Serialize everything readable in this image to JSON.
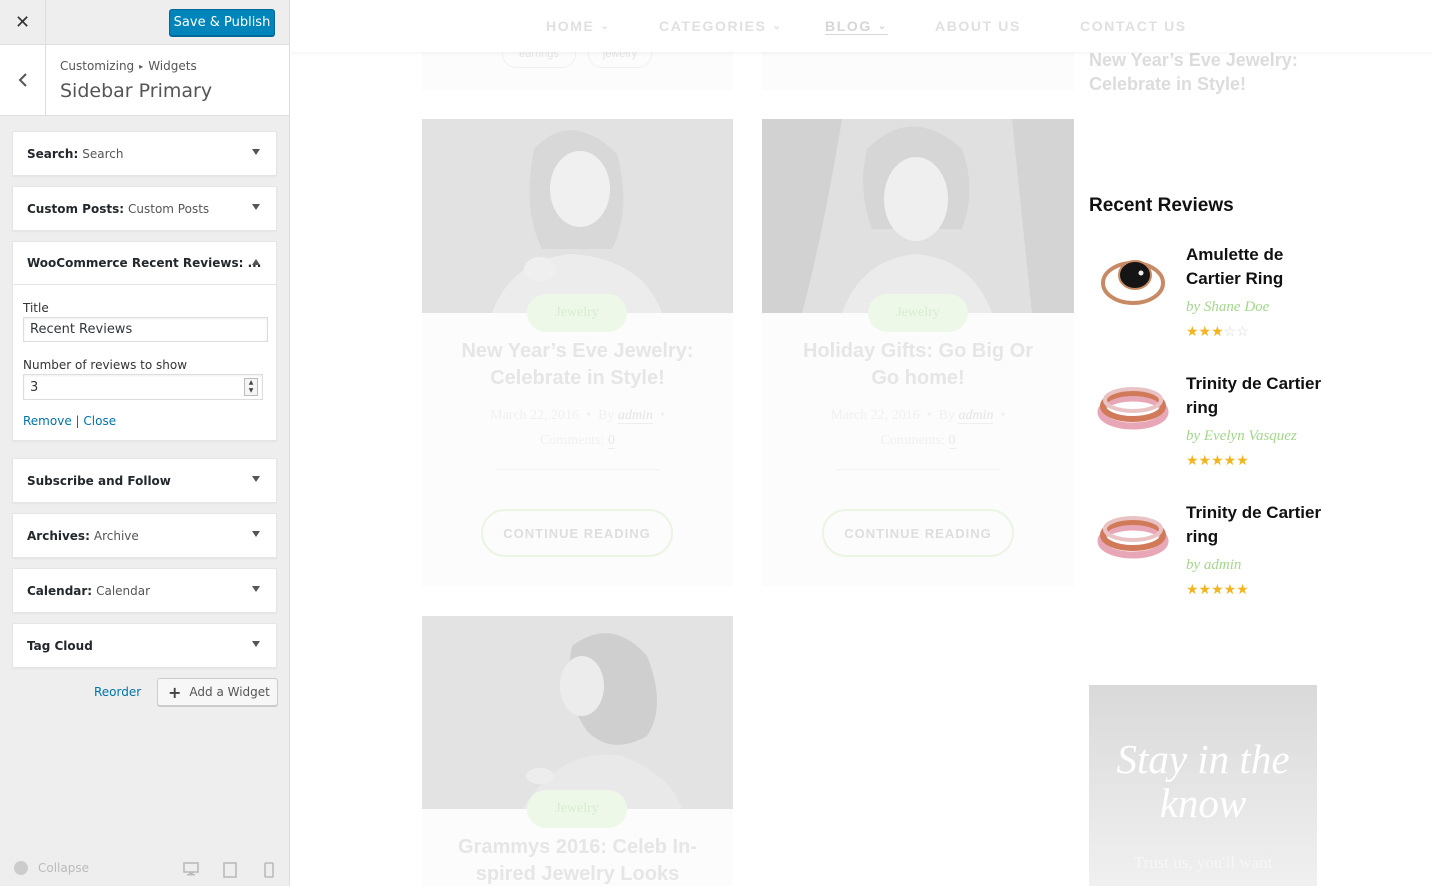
{
  "customizer": {
    "close_glyph": "✕",
    "publish_label": "Save & Publish",
    "breadcrumb": [
      "Customizing",
      "Widgets"
    ],
    "breadcrumb_sep": "▸",
    "section_title": "Sidebar Primary",
    "widgets": [
      {
        "name": "Search:",
        "title": "Search"
      },
      {
        "name": "Custom Posts:",
        "title": "Custom Posts"
      },
      {
        "name": "WooCommerce Recent Reviews: ...",
        "title": ""
      },
      {
        "name": "Subscribe and Follow",
        "title": ""
      },
      {
        "name": "Archives:",
        "title": "Archive"
      },
      {
        "name": "Calendar:",
        "title": "Calendar"
      },
      {
        "name": "Tag Cloud",
        "title": ""
      }
    ],
    "open_widget": {
      "title_label": "Title",
      "title_value": "Recent Reviews",
      "count_label": "Number of reviews to show",
      "count_value": "3",
      "remove_label": "Remove",
      "separator": "|",
      "close_label": "Close"
    },
    "reorder_label": "Reorder",
    "add_widget_label": "Add a Widget",
    "collapse_label": "Collapse"
  },
  "preview": {
    "nav": [
      "HOME",
      "CATEGORIES",
      "BLOG",
      "ABOUT US",
      "CONTACT US"
    ],
    "tags_top": [
      "earrings",
      "jewelry"
    ],
    "posts": [
      {
        "category": "Jewelry",
        "title_lines": [
          "New Year’s Eve Jewelry:",
          "Celebrate in Style!"
        ],
        "date": "March 22, 2016",
        "by": "By",
        "author": "admin",
        "comments_label": "Comments:",
        "comments": "0",
        "button": "CONTINUE READING"
      },
      {
        "category": "Jewelry",
        "title_lines": [
          "Holiday Gifts: Go Big Or",
          "Go home!"
        ],
        "date": "March 22, 2016",
        "by": "By",
        "author": "admin",
        "comments_label": "Comments:",
        "comments": "0",
        "button": "CONTINUE READING"
      },
      {
        "category": "Jewelry",
        "title_lines": [
          "Grammys 2016: Celeb In-",
          "spired Jewelry Looks"
        ]
      }
    ],
    "sidebar": {
      "prev_post_title": "New Year’s Eve Jewelry: Celebrate in Style!",
      "recent_reviews_heading": "Recent Reviews",
      "reviews": [
        {
          "product": "Amulette de Cartier Ring",
          "by": "by Shane Doe",
          "rating": 3
        },
        {
          "product": "Trinity de Cartier ring",
          "by": "by Evelyn Vasquez",
          "rating": 5
        },
        {
          "product": "Trinity de Cartier ring",
          "by": "by admin",
          "rating": 5
        }
      ],
      "stay_title": "Stay in the know",
      "stay_sub": "Trust us, you'll want"
    }
  }
}
